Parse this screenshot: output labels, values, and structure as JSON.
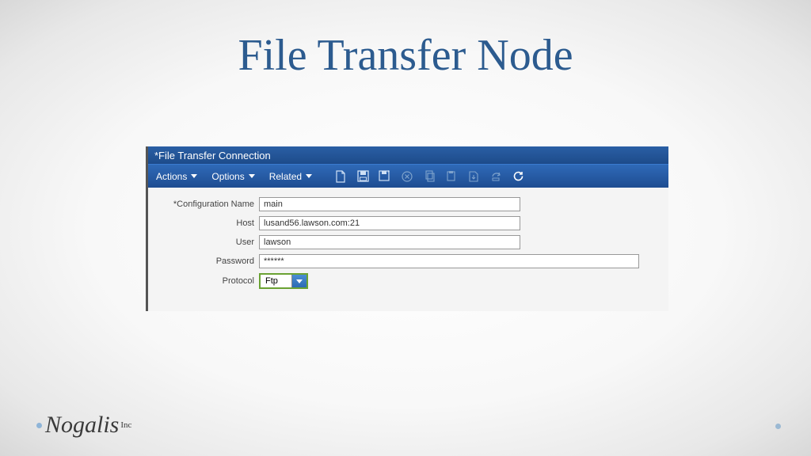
{
  "slide": {
    "title": "File Transfer Node"
  },
  "window": {
    "title": "*File Transfer Connection"
  },
  "menus": {
    "actions": "Actions",
    "options": "Options",
    "related": "Related"
  },
  "form": {
    "config_label": "*Configuration Name",
    "config_value": "main",
    "host_label": "Host",
    "host_value": "lusand56.lawson.com:21",
    "user_label": "User",
    "user_value": "lawson",
    "password_label": "Password",
    "password_value": "******",
    "protocol_label": "Protocol",
    "protocol_value": "Ftp"
  },
  "footer": {
    "brand": "Nogalis",
    "suffix": "Inc"
  }
}
